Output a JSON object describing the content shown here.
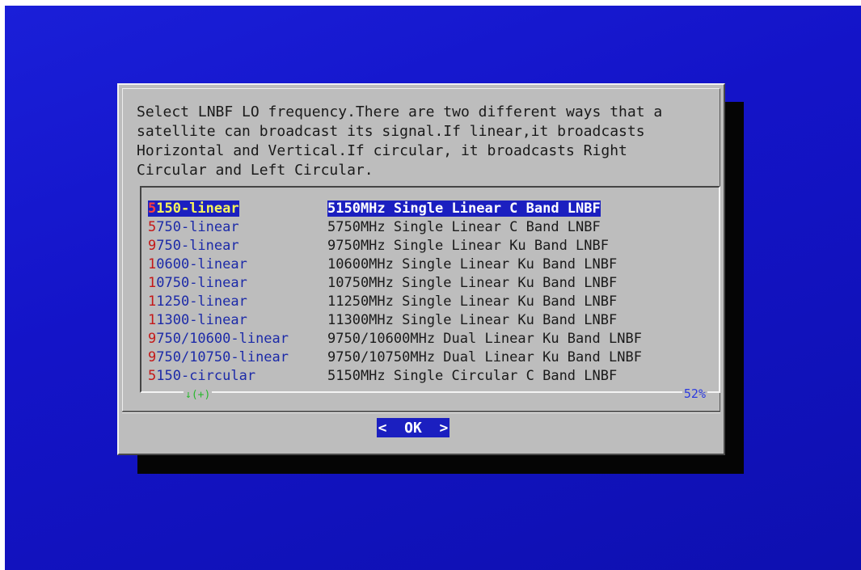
{
  "dialog": {
    "prompt": "Select LNBF LO frequency.There are two different ways that a\nsatellite can broadcast its signal.If linear,it broadcasts\nHorizontal and Vertical.If circular, it broadcasts Right\nCircular and Left Circular.",
    "menu": [
      {
        "hot": "5",
        "rest": "150-linear",
        "desc": "5150MHz Single Linear C Band LNBF",
        "selected": true
      },
      {
        "hot": "5",
        "rest": "750-linear",
        "desc": "5750MHz Single Linear C Band LNBF"
      },
      {
        "hot": "9",
        "rest": "750-linear",
        "desc": "9750MHz Single Linear Ku Band LNBF"
      },
      {
        "hot": "1",
        "rest": "0600-linear",
        "desc": "10600MHz Single Linear Ku Band LNBF"
      },
      {
        "hot": "1",
        "rest": "0750-linear",
        "desc": "10750MHz Single Linear Ku Band LNBF"
      },
      {
        "hot": "1",
        "rest": "1250-linear",
        "desc": "11250MHz Single Linear Ku Band LNBF"
      },
      {
        "hot": "1",
        "rest": "1300-linear",
        "desc": "11300MHz Single Linear Ku Band LNBF"
      },
      {
        "hot": "9",
        "rest": "750/10600-linear",
        "desc": "9750/10600MHz Dual Linear Ku Band LNBF"
      },
      {
        "hot": "9",
        "rest": "750/10750-linear",
        "desc": "9750/10750MHz Dual Linear Ku Band LNBF"
      },
      {
        "hot": "5",
        "rest": "150-circular",
        "desc": "5150MHz Single Circular C Band LNBF"
      }
    ],
    "scroll_indicator": "↓(+)",
    "scroll_percent": "52%",
    "ok_button": "<  OK  >"
  },
  "colors": {
    "background": "#1414c8",
    "dialog": "#bdbdbd",
    "highlight": "#1b1fc0",
    "tag_text": "#1c2aa8",
    "hotkey": "#c41818"
  }
}
